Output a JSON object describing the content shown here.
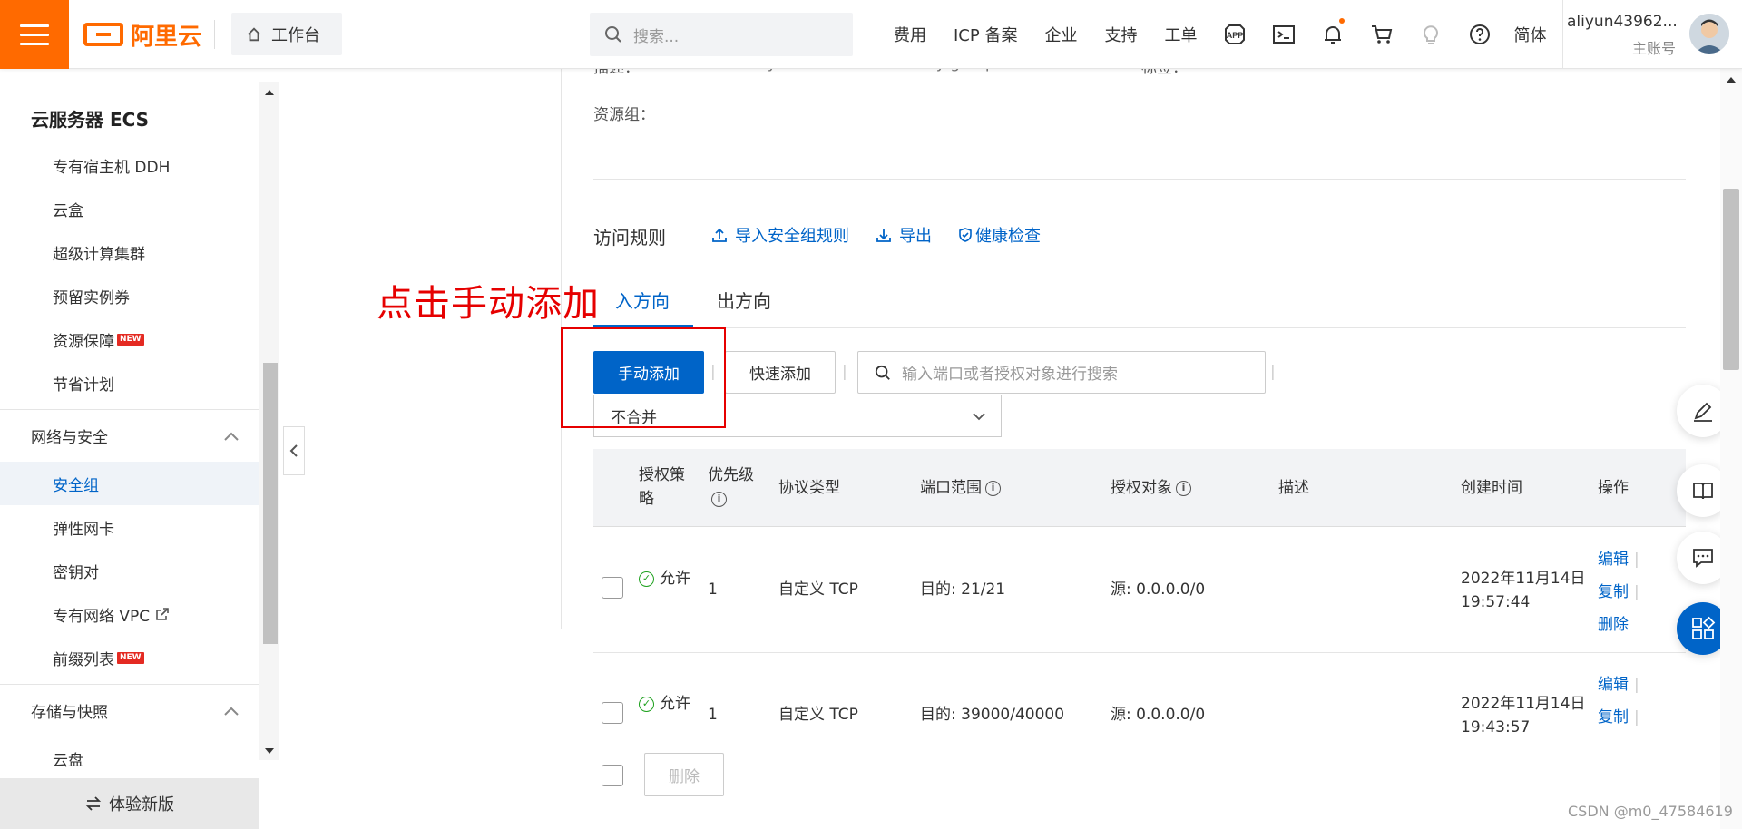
{
  "topbar": {
    "brand": "阿里云",
    "workbench": "工作台",
    "search_placeholder": "搜索...",
    "nav": [
      "费用",
      "ICP 备案",
      "企业",
      "支持",
      "工单"
    ],
    "icons": [
      "app-icon",
      "terminal-icon",
      "bell-icon",
      "cart-icon",
      "lightbulb-icon",
      "help-icon"
    ],
    "language": "简体",
    "user_name": "aliyun43962...",
    "user_role": "主账号"
  },
  "sidebar": {
    "title": "云服务器 ECS",
    "items_top": [
      {
        "label": "专有宿主机 DDH",
        "badge": ""
      },
      {
        "label": "云盒",
        "badge": ""
      },
      {
        "label": "超级计算集群",
        "badge": ""
      },
      {
        "label": "预留实例券",
        "badge": ""
      },
      {
        "label": "资源保障",
        "badge": "NEW"
      },
      {
        "label": "节省计划",
        "badge": ""
      }
    ],
    "group_network": "网络与安全",
    "items_network": [
      {
        "label": "安全组",
        "badge": "",
        "active": true
      },
      {
        "label": "弹性网卡",
        "badge": ""
      },
      {
        "label": "密钥对",
        "badge": ""
      },
      {
        "label": "专有网络 VPC",
        "badge": ""
      },
      {
        "label": "前缀列表",
        "badge": "NEW"
      }
    ],
    "group_storage": "存储与快照",
    "items_storage": [
      {
        "label": "云盘"
      }
    ],
    "footer": "体验新版"
  },
  "details": {
    "description_label": "描述：",
    "description_value": "System created security group.",
    "tag_label": "标签：",
    "resource_group_label": "资源组："
  },
  "rules": {
    "title": "访问规则",
    "import": "导入安全组规则",
    "export": "导出",
    "health_check": "健康检查",
    "tab_in": "入方向",
    "tab_out": "出方向",
    "btn_manual": "手动添加",
    "btn_quick": "快速添加",
    "search_placeholder": "输入端口或者授权对象进行搜索",
    "merge_select": "不合并",
    "annotation": "点击手动添加"
  },
  "table": {
    "headers": {
      "policy": "授权策略",
      "priority": "优先级",
      "protocol": "协议类型",
      "port": "端口范围",
      "target": "授权对象",
      "desc": "描述",
      "created": "创建时间",
      "ops": "操作"
    },
    "rows": [
      {
        "policy": "允许",
        "priority": "1",
        "protocol": "自定义 TCP",
        "port": "目的: 21/21",
        "target": "源: 0.0.0.0/0",
        "desc": "",
        "date": "2022年11月14日",
        "time": "19:57:44",
        "ops": [
          "编辑",
          "复制",
          "删除"
        ]
      },
      {
        "policy": "允许",
        "priority": "1",
        "protocol": "自定义 TCP",
        "port": "目的: 39000/40000",
        "target": "源: 0.0.0.0/0",
        "desc": "",
        "date": "2022年11月14日",
        "time": "19:43:57",
        "ops": [
          "编辑",
          "复制"
        ]
      }
    ],
    "bulk_delete": "删除"
  },
  "watermark": "CSDN @m0_47584619",
  "colors": {
    "brand": "#ff6a00",
    "primary": "#0064c8",
    "annotation": "#e60000",
    "allow": "#1ea11e"
  }
}
